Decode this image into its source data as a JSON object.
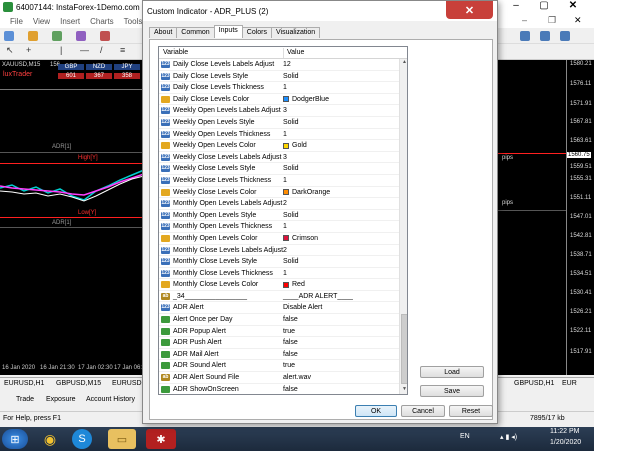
{
  "mt4": {
    "title": "64007144: InstaForex-1Demo.com - Demo",
    "menu": [
      "File",
      "View",
      "Insert",
      "Charts",
      "Tools"
    ],
    "chart": {
      "symbol": "XAUUSD,M15",
      "symbol_extra": "156",
      "label_adr": "ADR[1]",
      "label_high": "High[Y]",
      "label_low": "Low[Y]",
      "label_adr2": "ADR[1]",
      "brand": "luxTrader",
      "currencies": [
        "GBP",
        "NZD",
        "JPY"
      ],
      "currency_values": [
        "601",
        "367",
        "358"
      ],
      "dates": [
        "16 Jan 2020",
        "16 Jan 21:30",
        "17 Jan 02:30",
        "17 Jan 06:"
      ],
      "pips_top": "pips",
      "pips_mid": "pips"
    },
    "price_axis": [
      "1580.21",
      "1576.11",
      "1571.91",
      "1567.81",
      "1563.61",
      "1559.51",
      "1555.31",
      "1551.11",
      "1547.01",
      "1542.81",
      "1538.71",
      "1534.51",
      "1530.41",
      "1526.21",
      "1522.11",
      "1517.91"
    ],
    "price_current": "1560.75",
    "chart_tabs": [
      "EURUSD,H1",
      "GBPUSD,M15",
      "EURUSD",
      "GBPUSD,H1",
      "EUR"
    ],
    "terminal_tabs": [
      "Trade",
      "Exposure",
      "Account History"
    ],
    "status_left": "For Help, press F1",
    "status_right": "7895/17 kb"
  },
  "taskbar": {
    "lang": "EN",
    "time": "11:22 PM",
    "date": "1/20/2020"
  },
  "dialog": {
    "title": "Custom Indicator - ADR_PLUS (2)",
    "close_glyph": "✕",
    "tabs": [
      "About",
      "Common",
      "Inputs",
      "Colors",
      "Visualization"
    ],
    "active_tab": 2,
    "columns": {
      "variable": "Variable",
      "value": "Value"
    },
    "rows": [
      {
        "name": "Daily Close Levels Labels Adjust",
        "value": "12",
        "icon": "num"
      },
      {
        "name": "Daily Close Levels Style",
        "value": "Solid",
        "icon": "num"
      },
      {
        "name": "Daily Close Levels Thickness",
        "value": "1",
        "icon": "num"
      },
      {
        "name": "Daily Close Levels Color",
        "value": "DodgerBlue",
        "icon": "color",
        "color": "#1e90ff"
      },
      {
        "name": "Weekly Open Levels Labels Adjust",
        "value": "3",
        "icon": "num"
      },
      {
        "name": "Weekly Open Levels Style",
        "value": "Solid",
        "icon": "num"
      },
      {
        "name": "Weekly Open Levels Thickness",
        "value": "1",
        "icon": "num"
      },
      {
        "name": "Weekly Open Levels Color",
        "value": "Gold",
        "icon": "color",
        "color": "#ffd700"
      },
      {
        "name": "Weekly Close Levels Labels Adjust",
        "value": "3",
        "icon": "num"
      },
      {
        "name": "Weekly Close Levels Style",
        "value": "Solid",
        "icon": "num"
      },
      {
        "name": "Weekly Close Levels Thickness",
        "value": "1",
        "icon": "num"
      },
      {
        "name": "Weekly Close Levels Color",
        "value": "DarkOrange",
        "icon": "color",
        "color": "#ff8c00"
      },
      {
        "name": "Monthly Open Levels Labels Adjust",
        "value": "2",
        "icon": "num"
      },
      {
        "name": "Monthly Open Levels Style",
        "value": "Solid",
        "icon": "num"
      },
      {
        "name": "Monthly Open Levels Thickness",
        "value": "1",
        "icon": "num"
      },
      {
        "name": "Monthly Open Levels Color",
        "value": "Crimson",
        "icon": "color",
        "color": "#dc143c"
      },
      {
        "name": "Monthly Close Levels Labels Adjust",
        "value": "2",
        "icon": "num"
      },
      {
        "name": "Monthly Close Levels Style",
        "value": "Solid",
        "icon": "num"
      },
      {
        "name": "Monthly Close Levels Thickness",
        "value": "1",
        "icon": "num"
      },
      {
        "name": "Monthly Close Levels Color",
        "value": "Red",
        "icon": "color",
        "color": "#ff0000"
      },
      {
        "name": "_34________________",
        "value": "____ADR ALERT____",
        "icon": "str"
      },
      {
        "name": "ADR Alert",
        "value": "Disable Alert",
        "icon": "num"
      },
      {
        "name": "Alert Once per Day",
        "value": "false",
        "icon": "bool"
      },
      {
        "name": "ADR Popup Alert",
        "value": "true",
        "icon": "bool"
      },
      {
        "name": "ADR Push Alert",
        "value": "false",
        "icon": "bool"
      },
      {
        "name": "ADR Mail Alert",
        "value": "false",
        "icon": "bool"
      },
      {
        "name": "ADR Sound Alert",
        "value": "true",
        "icon": "bool"
      },
      {
        "name": "ADR Alert Sound File",
        "value": "alert.wav",
        "icon": "str"
      },
      {
        "name": "ADR ShowOnScreen",
        "value": "false",
        "icon": "bool"
      }
    ],
    "buttons": {
      "load": "Load",
      "save": "Save",
      "ok": "OK",
      "cancel": "Cancel",
      "reset": "Reset"
    }
  },
  "colors": {
    "chart_bg": "#000000",
    "high_line": "#ff2020",
    "low_line": "#ff2020",
    "selected_tab": "#ffffff",
    "close_button": "#c8403a"
  }
}
